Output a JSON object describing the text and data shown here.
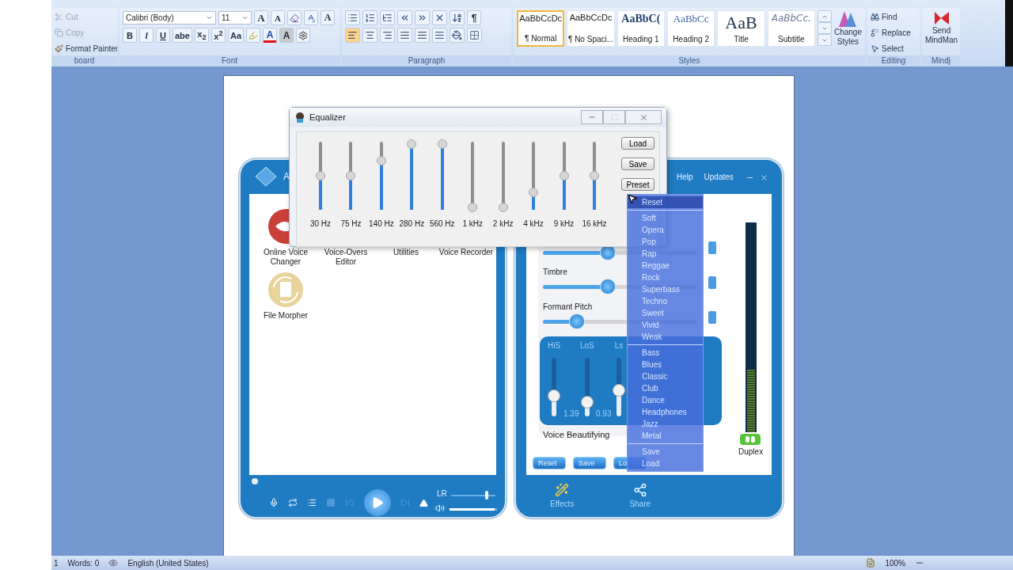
{
  "ribbon": {
    "clipboard": {
      "items": [
        {
          "label": "Cut",
          "kind": "cut",
          "disabled": true
        },
        {
          "label": "Copy",
          "kind": "copy",
          "disabled": true
        },
        {
          "label": "Format Painter",
          "kind": "painter",
          "disabled": false
        }
      ],
      "group_label": "board"
    },
    "font": {
      "font_name": "Calibri (Body)",
      "font_size": "11",
      "size_buttons": [
        "A",
        "A"
      ],
      "text_effect": "A",
      "format_buttons": [
        "B",
        "I",
        "U",
        "abe",
        "x$_{2}$",
        "x$^{2}$",
        "Aa"
      ],
      "font_color": "A",
      "shading": "A",
      "group_label": "Font"
    },
    "paragraph": {
      "alignments": [
        {
          "kind": "left",
          "selected": true
        },
        {
          "kind": "center",
          "selected": false
        },
        {
          "kind": "right",
          "selected": false
        },
        {
          "kind": "justify",
          "selected": false
        },
        {
          "kind": "distributed",
          "selected": false
        }
      ],
      "pilcrow": "¶",
      "group_label": "Paragraph"
    },
    "styles": {
      "items": [
        {
          "sample": "AaBbCcDc",
          "label": "¶ Normal",
          "kind": "normal",
          "selected": true
        },
        {
          "sample": "AaBbCcDc",
          "label": "¶ No Spaci...",
          "kind": "normal",
          "selected": false
        },
        {
          "sample": "AaBbC(",
          "label": "Heading 1",
          "kind": "heading1",
          "selected": false
        },
        {
          "sample": "AaBbCc",
          "label": "Heading 2",
          "kind": "heading2",
          "selected": false
        },
        {
          "sample": "AaB",
          "label": "Title",
          "kind": "title",
          "selected": false
        },
        {
          "sample": "AaBbCc.",
          "label": "Subtitle",
          "kind": "subtitle",
          "selected": false
        }
      ],
      "change_styles": [
        "Change",
        "Styles"
      ],
      "group_label": "Styles"
    },
    "editing": {
      "items": [
        {
          "label": "Find",
          "kind": "find"
        },
        {
          "label": "Replace",
          "kind": "replace"
        },
        {
          "label": "Select",
          "kind": "select"
        }
      ],
      "group_label": "Editing"
    },
    "mindjet": {
      "label_lines": [
        "Send",
        "MindMan"
      ],
      "group_label": "Mindj"
    }
  },
  "equalizer": {
    "title": "Equalizer",
    "bands": [
      {
        "label": "30 Hz",
        "level": 0.5
      },
      {
        "label": "75 Hz",
        "level": 0.5
      },
      {
        "label": "140 Hz",
        "level": 0.72
      },
      {
        "label": "280 Hz",
        "level": 0.97
      },
      {
        "label": "560 Hz",
        "level": 0.97
      },
      {
        "label": "1 kHz",
        "level": 0.03
      },
      {
        "label": "2 kHz",
        "level": 0.03
      },
      {
        "label": "4 kHz",
        "level": 0.26
      },
      {
        "label": "9 kHz",
        "level": 0.5
      },
      {
        "label": "16 kHz",
        "level": 0.5
      }
    ],
    "buttons": [
      "Load",
      "Save",
      "Preset"
    ]
  },
  "preset_menu": {
    "groups": [
      [
        {
          "label": "Reset",
          "highlighted": true
        }
      ],
      [
        {
          "label": "Soft",
          "highlighted": false
        },
        {
          "label": "Opera",
          "highlighted": false
        },
        {
          "label": "Pop",
          "highlighted": false
        },
        {
          "label": "Rap",
          "highlighted": false
        },
        {
          "label": "Reggae",
          "highlighted": false
        },
        {
          "label": "Rock",
          "highlighted": false
        },
        {
          "label": "Superbass",
          "highlighted": false
        },
        {
          "label": "Techno",
          "highlighted": false
        },
        {
          "label": "Sweet",
          "highlighted": false
        },
        {
          "label": "Vivid",
          "highlighted": false
        },
        {
          "label": "Weak",
          "highlighted": false
        }
      ],
      [
        {
          "label": "Bass",
          "highlighted": false
        },
        {
          "label": "Blues",
          "highlighted": false
        },
        {
          "label": "Classic",
          "highlighted": false
        },
        {
          "label": "Club",
          "highlighted": false
        },
        {
          "label": "Dance",
          "highlighted": false
        },
        {
          "label": "Headphones",
          "highlighted": false
        },
        {
          "label": "Jazz",
          "highlighted": false
        },
        {
          "label": "Metal",
          "highlighted": false
        }
      ],
      [
        {
          "label": "Save",
          "highlighted": false
        },
        {
          "label": "Load",
          "highlighted": false
        }
      ]
    ]
  },
  "voice_changer": {
    "title": "A",
    "apps": [
      {
        "label": "Online Voice Changer",
        "kind": "lips"
      },
      {
        "label": "Voice-Overs Editor",
        "kind": "covered"
      },
      {
        "label": "Utilities",
        "kind": "covered"
      },
      {
        "label": "Voice Recorder",
        "kind": "covered"
      },
      {
        "label": "File Morpher",
        "kind": "morpher"
      }
    ],
    "player": {
      "balance": {
        "label": "LR",
        "level": 0.8
      },
      "volume": {
        "level": 0.95
      }
    }
  },
  "effects_window": {
    "menu": [
      "Help",
      "Updates"
    ],
    "sliders": [
      {
        "level": 0.42
      },
      {
        "label": "Timbre",
        "level": 0.42
      },
      {
        "label": "Formant Pitch",
        "level": 0.22
      }
    ],
    "beautifying": {
      "title": "Voice Beautifying",
      "faders": [
        {
          "label": "HiS",
          "value": "1.39",
          "level": 0.35
        },
        {
          "label": "LoS",
          "value": "0.93",
          "level": 0.25
        },
        {
          "label": "Ls",
          "level": 0.45
        }
      ]
    },
    "buttons": [
      "Reset",
      "Save",
      "Lo"
    ],
    "meter": {
      "level": 0.3
    },
    "duplex": {
      "label": "Duplex",
      "on": true
    },
    "tabs": [
      {
        "label": "Effects",
        "kind": "effects"
      },
      {
        "label": "Share",
        "kind": "share"
      }
    ]
  },
  "status_bar": {
    "page": "1",
    "words": "Words: 0",
    "language": "English (United States)",
    "zoom": "100%"
  }
}
